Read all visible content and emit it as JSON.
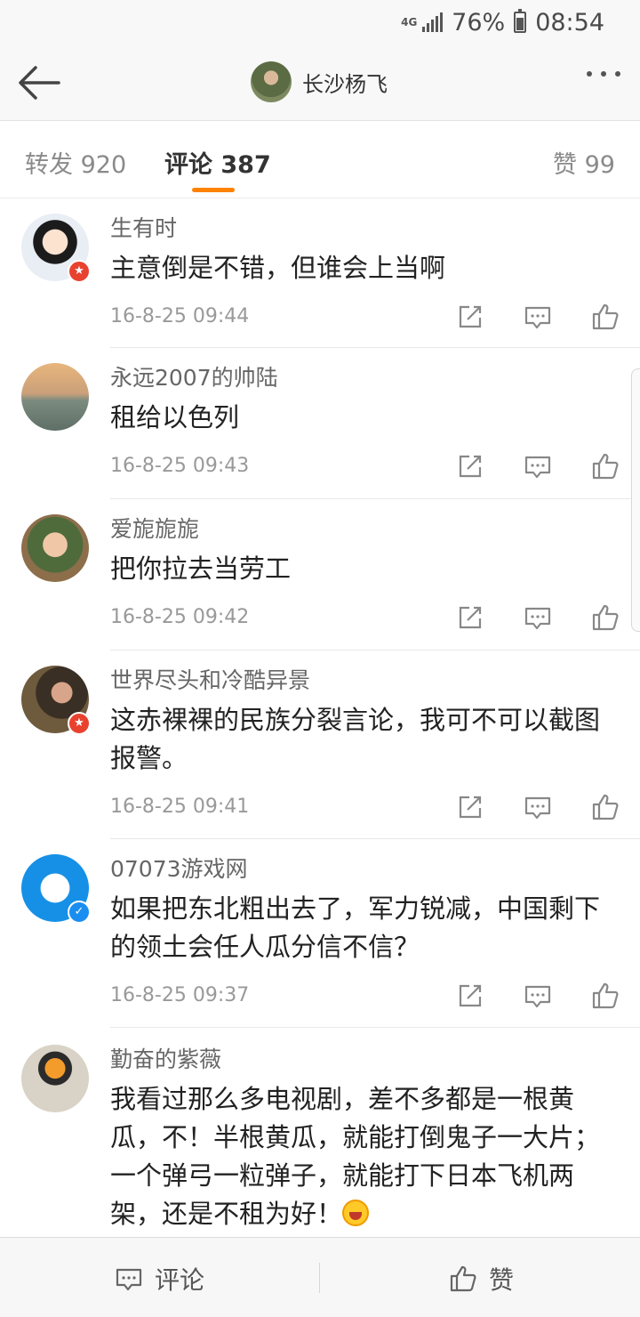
{
  "status_bar": {
    "network": "4G",
    "battery": "76%",
    "battery_level": 0.76,
    "time": "08:54"
  },
  "header": {
    "title": "长沙杨飞"
  },
  "tabs": {
    "repost": "转发 920",
    "comments": "评论 387",
    "likes": "赞 99"
  },
  "comments": [
    {
      "username": "生有时",
      "text": "主意倒是不错，但谁会上当啊",
      "time": "16-8-25 09:44",
      "badge": "red"
    },
    {
      "username": "永远2007的帅陆",
      "text": "租给以色列",
      "time": "16-8-25 09:43",
      "badge": ""
    },
    {
      "username": "爱旎旎旎",
      "text": "把你拉去当劳工",
      "time": "16-8-25 09:42",
      "badge": ""
    },
    {
      "username": "世界尽头和冷酷异景",
      "text": "这赤裸裸的民族分裂言论，我可不可以截图报警。",
      "time": "16-8-25 09:41",
      "badge": "red"
    },
    {
      "username": "07073游戏网",
      "text": "如果把东北粗出去了，军力锐减，中国剩下的领土会任人瓜分信不信？",
      "time": "16-8-25 09:37",
      "badge": "blue"
    },
    {
      "username": "勤奋的紫薇",
      "text": "我看过那么多电视剧，差不多都是一根黄瓜，不！半根黄瓜，就能打倒鬼子一大片；一个弹弓一粒弹子，就能打下日本飞机两架，还是不租为好！",
      "time": "",
      "badge": ""
    }
  ],
  "bottom_bar": {
    "comment_label": "评论",
    "like_label": "赞"
  },
  "colors": {
    "accent": "#ff8200",
    "verified_red": "#e8422f",
    "verified_blue": "#1a8ef0"
  }
}
